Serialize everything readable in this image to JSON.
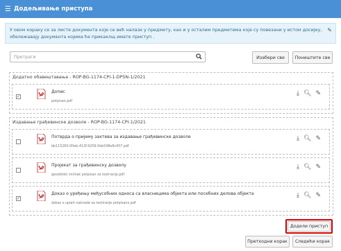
{
  "header": {
    "title": "Додељивање приступа",
    "menu_icon": "hamburger-icon"
  },
  "info": {
    "text": "У овом кораку се за листе документа које се већ налазе у предмету, као и у осталим предметима које су повезани у истом досијеу, обележавају документа којима ћe прикаклщ имате приступ .",
    "pin_icon": "pin-icon"
  },
  "search": {
    "placeholder": "Претраги",
    "icon": "search-icon"
  },
  "toolbar": {
    "select_all": "Изабери све",
    "clear_all": "Поништите све"
  },
  "groups": [
    {
      "title": "Додатно обавештавање - ROP-BG-1174-CPI-1-DPSN-1/2021",
      "docs": [
        {
          "name": "Допис",
          "file": "potpisan.pdf",
          "checked": true
        }
      ]
    },
    {
      "title": "Издавање грађевинске дозволе - ROP-BG-1174-CPI-1/2021",
      "docs": [
        {
          "name": "Потврда о пријему захтева за издавање грађевинске дозволе",
          "file": "bb115260-00eb-413f-9259-0de548e8c457.pdf",
          "checked": false
        },
        {
          "name": "Пројекат за грађевинску дозволу",
          "file": "geodetski snimak potpisan za testiranje.pdf",
          "checked": false
        },
        {
          "name": "Доказ о уређењу међусобних односа са власницима објекта или посебних делова објекта",
          "file": "dokaz o uplati naknade za testiranje potpisano.pdf",
          "checked": true
        }
      ]
    }
  ],
  "actions": {
    "add_access": "Додели приступ",
    "prev": "Претходни корак",
    "next": "Следећи корак"
  },
  "doc_icons": [
    "download-icon",
    "search-icon",
    "pencil-icon"
  ],
  "colors": {
    "header": "#4a90d6",
    "info_bg": "#e7f3fa",
    "highlight": "#dd0000",
    "pdf_red": "#c62828"
  }
}
